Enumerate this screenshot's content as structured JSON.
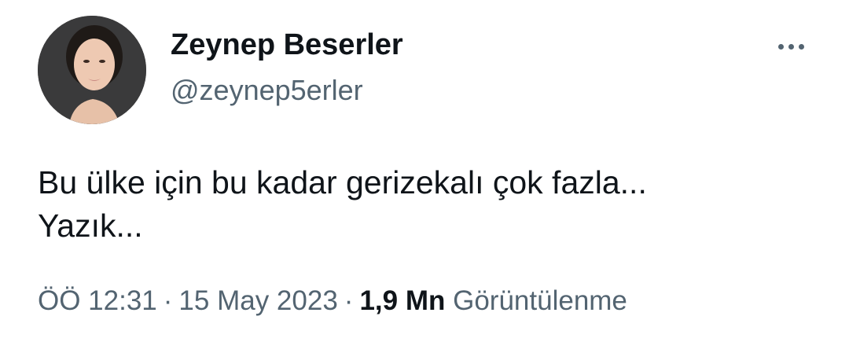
{
  "user": {
    "display_name": "Zeynep Beserler",
    "handle": "@zeynep5erler"
  },
  "tweet": {
    "lines": [
      "Bu ülke için bu kadar gerizekalı çok fazla...",
      "Yazık..."
    ]
  },
  "meta": {
    "time": "ÖÖ 12:31",
    "separator": "·",
    "date": "15 May 2023",
    "views_count": "1,9 Mn",
    "views_label": "Görüntülenme"
  },
  "icons": {
    "more": "more-horizontal-icon",
    "avatar": "profile-photo"
  },
  "colors": {
    "text_primary": "#0f1419",
    "text_secondary": "#536471",
    "background": "#ffffff"
  }
}
